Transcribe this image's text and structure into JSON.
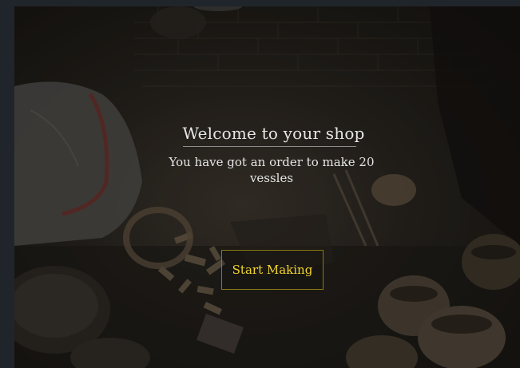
{
  "dialog": {
    "title": "Welcome to your shop",
    "message": "You have got an order to make 20 vessles",
    "start_button_label": "Start Making"
  },
  "colors": {
    "title_text": "#e6e6e6",
    "button_text": "#f2d52b",
    "button_border": "#8a7a12",
    "frame": "#1f252b"
  }
}
